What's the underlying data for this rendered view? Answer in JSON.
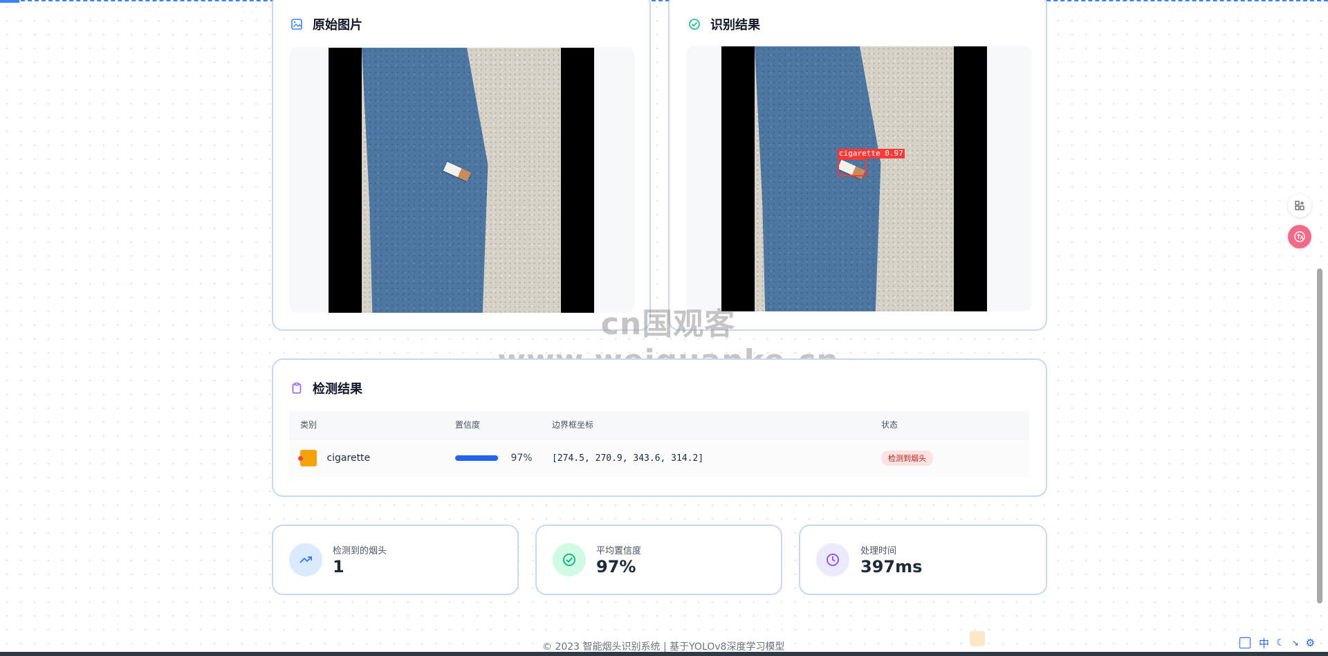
{
  "original_image": {
    "title": "原始图片"
  },
  "result_image": {
    "title": "识别结果",
    "detection_label": "cigarette 0.97"
  },
  "watermark": "cn国观客www.weiguanke.cn",
  "detection": {
    "title": "检测结果",
    "headers": [
      "类别",
      "置信度",
      "边界框坐标",
      "状态"
    ],
    "rows": [
      {
        "class": "cigarette",
        "confidence_fraction": 0.97,
        "confidence_text": "97%",
        "bbox": "[274.5, 270.9, 343.6, 314.2]",
        "status": "检测到烟头"
      }
    ]
  },
  "stats": [
    {
      "label": "检测到的烟头",
      "value": "1",
      "icon": "trending-up-icon",
      "color": "#3b82f6",
      "bg": "#dbeafe"
    },
    {
      "label": "平均置信度",
      "value": "97%",
      "icon": "check-circle-icon",
      "color": "#10b981",
      "bg": "#d1fae5"
    },
    {
      "label": "处理时间",
      "value": "397ms",
      "icon": "clock-icon",
      "color": "#8b5cf6",
      "bg": "#ede9fe"
    }
  ],
  "footer": "© 2023 智能烟头识别系统 | 基于YOLOv8深度学习模型",
  "tray": {
    "ime": "中"
  },
  "colors": {
    "card_border": "#c9d8f0",
    "accent": "#2563eb",
    "box": "#ff3838"
  }
}
